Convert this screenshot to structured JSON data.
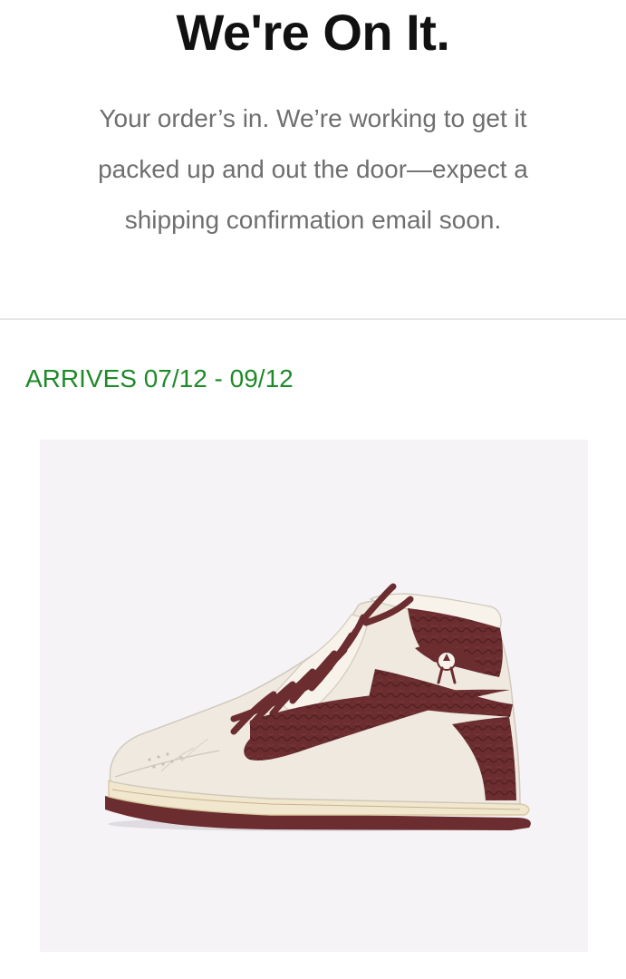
{
  "header": {
    "title": "We're On It.",
    "message": "Your order’s in. We’re working to get it packed up and out the door—expect a shipping confirmation email soon."
  },
  "order": {
    "arrival_text": "ARRIVES 07/12 - 09/12",
    "arrival_color": "#1f8a2a",
    "product_image": "sneaker-high-top-image"
  },
  "colors": {
    "card_background": "#f5f3f6",
    "sneaker_leather": "#efe9df",
    "sneaker_accent": "#6b2d2f",
    "sole": "#f1e7ce"
  }
}
